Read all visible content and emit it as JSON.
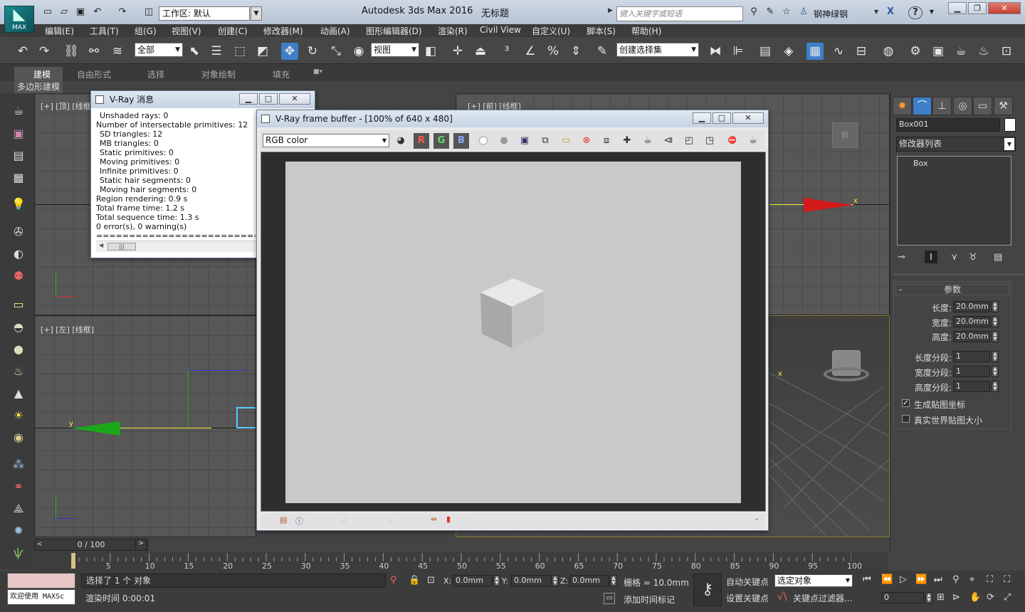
{
  "app": {
    "title": "Autodesk 3ds Max 2016",
    "doc": "无标题",
    "logo": "MAX",
    "workspace": "工作区: 默认",
    "search_placeholder": "键入关键字或短语",
    "user": "钢神绿钢"
  },
  "menu": [
    "编辑(E)",
    "工具(T)",
    "组(G)",
    "视图(V)",
    "创建(C)",
    "修改器(M)",
    "动画(A)",
    "图形编辑器(D)",
    "渲染(R)",
    "Civil View",
    "自定义(U)",
    "脚本(S)",
    "帮助(H)"
  ],
  "toolbar": {
    "selection_filter": "全部",
    "ref_coord": "视图",
    "named_selection": "创建选择集"
  },
  "ribbon": {
    "tabs": [
      "建模",
      "自由形式",
      "选择",
      "对象绘制",
      "填充"
    ],
    "subtab": "多边形建模"
  },
  "viewports": {
    "top": "[+] [顶] [线框]",
    "front": "[+] [前] [线框]",
    "left": "[+] [左] [线框]",
    "y_axis": "y",
    "x_axis": "x"
  },
  "vray_messages": {
    "title": "V-Ray 消息",
    "lines": [
      "Unshaded rays: 0",
      "Number of intersectable primitives: 12",
      "SD triangles: 12",
      "MB triangles: 0",
      "Static primitives: 0",
      "Moving primitives: 0",
      "Infinite primitives: 0",
      "Static hair segments: 0",
      "Moving hair segments: 0",
      "Region rendering: 0.9 s",
      "Total frame time: 1.2 s",
      "Total sequence time: 1.3 s",
      "0 error(s), 0 warning(s)",
      "================================"
    ],
    "indented": [
      true,
      false,
      true,
      true,
      true,
      true,
      true,
      true,
      true,
      false,
      false,
      false,
      false,
      false
    ],
    "scroll_thumb": "|||"
  },
  "frame_buffer": {
    "title": "V-Ray frame buffer - [100% of 640 x 480]",
    "channel": "RGB color",
    "r": "R",
    "g": "G",
    "b": "B"
  },
  "command_panel": {
    "object_name": "Box001",
    "modifier_list": "修改器列表",
    "stack": [
      "Box"
    ],
    "rollout": "参数",
    "params": [
      {
        "label": "长度:",
        "value": "20.0mm"
      },
      {
        "label": "宽度:",
        "value": "20.0mm"
      },
      {
        "label": "高度:",
        "value": "20.0mm"
      },
      {
        "label": "长度分段:",
        "value": "1"
      },
      {
        "label": "宽度分段:",
        "value": "1"
      },
      {
        "label": "高度分段:",
        "value": "1"
      }
    ],
    "gen_mapping": "生成贴图坐标",
    "real_world": "真实世界贴图大小",
    "gen_mapping_checked": true,
    "real_world_checked": false
  },
  "timeline": {
    "slider": "0 / 100",
    "ticks": [
      "5",
      "10",
      "15",
      "20",
      "25",
      "30",
      "35",
      "40",
      "45",
      "50",
      "55",
      "60",
      "65",
      "70",
      "75",
      "80",
      "85",
      "90",
      "95",
      "100"
    ]
  },
  "status": {
    "welcome": "欢迎使用 MAXSc",
    "selected": "选择了 1 个 对象",
    "render_time": "渲染时间 0:00:01",
    "x_label": "X:",
    "x": "0.0mm",
    "y_label": "Y:",
    "y": "0.0mm",
    "z_label": "Z:",
    "z": "0.0mm",
    "grid": "栅格 = 10.0mm",
    "add_time_tag": "添加时间标记",
    "auto_key": "自动关键点",
    "set_key": "设置关键点",
    "selected_obj": "选定对象",
    "key_filters": "关键点过滤器...",
    "frame": "0"
  },
  "colors": {
    "accent": "#3d7fc8",
    "viewport_bg": "#575757",
    "fb_image": "#c9c9c9"
  }
}
